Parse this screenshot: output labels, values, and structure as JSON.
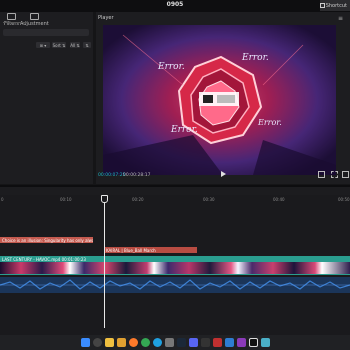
{
  "window": {
    "title": "0905"
  },
  "shortcuts": {
    "label": "Shortcut"
  },
  "left_panel": {
    "tabs": [
      {
        "label": "Filters"
      },
      {
        "label": "Adjustment"
      }
    ],
    "controls": [
      {
        "label": "⊞ ▾"
      },
      {
        "label": "Sort ⇅"
      },
      {
        "label": "All ⇅"
      },
      {
        "label": "⇅"
      }
    ]
  },
  "player": {
    "label": "Player",
    "current_time": "00:00:07:25",
    "duration": "00:00:28:17",
    "overlay_texts": [
      "Error.",
      "Error.",
      "Error.",
      "Error."
    ]
  },
  "timeline": {
    "ruler_ticks": [
      "0",
      "00:10",
      "00:20",
      "00:30",
      "00:40",
      "00:50"
    ],
    "tracks": {
      "text_clip": "Choice is an illusion: Singularity has only always b",
      "audio_clip_1": "KAIRAL | Blue_Ball March",
      "video_clip": "LAST CENTURY - HAVOC.mp4 00:01:00:23"
    }
  },
  "colors": {
    "accent": "#1bb6c4",
    "text_clip": "#c45a4f",
    "audio_clip": "#b84c42",
    "video_clip": "#2a9d8f",
    "audio_wave": "#2b5fa6"
  },
  "taskbar": {
    "icons": [
      "windows-icon",
      "search-icon",
      "file-explorer-icon",
      "folder-icon",
      "firefox-icon",
      "chrome-icon",
      "edge-icon",
      "settings-icon",
      "steam-icon",
      "discord-icon",
      "terminal-icon",
      "game-icon",
      "store-icon",
      "app-icon",
      "capcut-icon",
      "photos-icon"
    ]
  }
}
